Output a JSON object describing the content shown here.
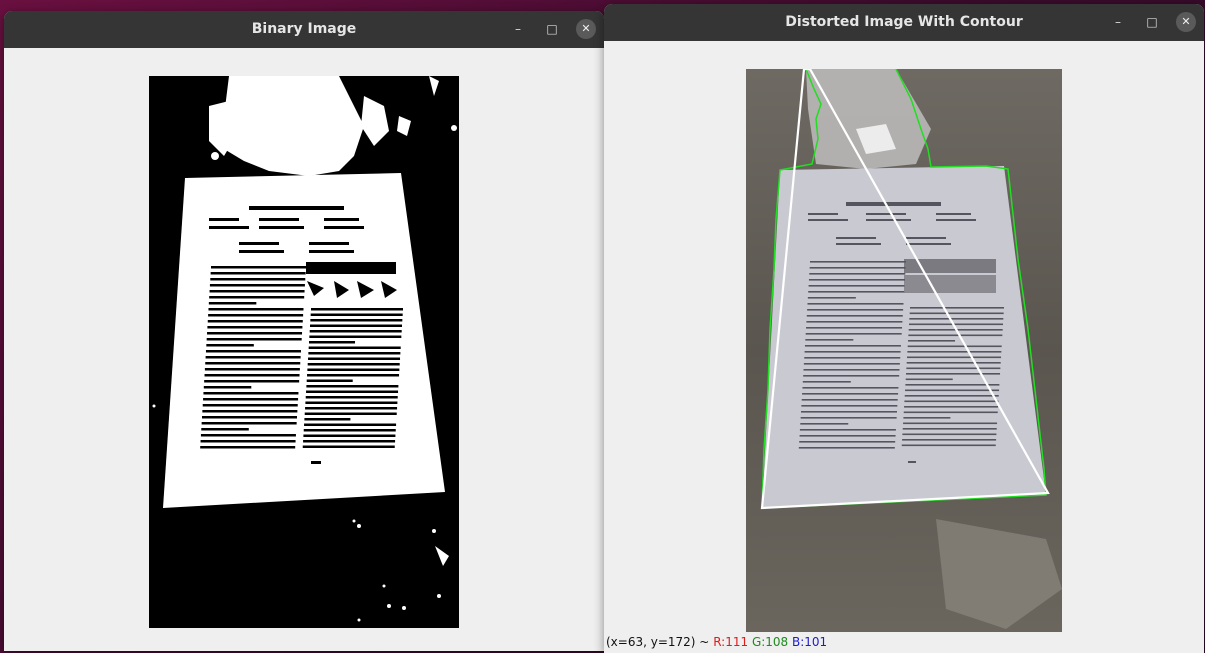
{
  "windows": [
    {
      "title": "Binary Image",
      "controls": {
        "minimize_icon": "minimize-icon",
        "maximize_icon": "maximize-icon",
        "close_icon": "close-icon"
      }
    },
    {
      "title": "Distorted Image With Contour",
      "controls": {
        "minimize_icon": "minimize-icon",
        "maximize_icon": "maximize-icon",
        "close_icon": "close-icon"
      },
      "status": {
        "coords": "(x=63, y=172) ~",
        "r": "R:111",
        "g": "G:108",
        "b": "B:101"
      }
    }
  ],
  "paper": {
    "title": "Video Visual Relation Detection",
    "sections": [
      "ABSTRACT",
      "CCS CONCEPTS",
      "KEYWORDS",
      "1 INTRODUCTION"
    ]
  },
  "colors": {
    "titlebar": "#353535",
    "window_bg": "#efefef",
    "contour": "#22dd22",
    "quad": "#ffffff",
    "status_r": "#e01b1b",
    "status_g": "#1d8a1d",
    "status_b": "#1b1bd0"
  }
}
